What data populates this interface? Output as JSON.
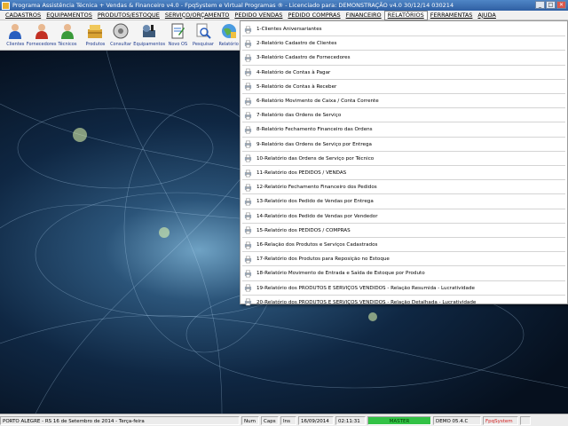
{
  "window": {
    "title": "Programa Assistência Técnica + Vendas & Financeiro v4.0 - FpqSystem e Virtual Programas ® - Licenciado para: DEMONSTRAÇÃO v4.0 30/12/14 030214",
    "minimize": "_",
    "maximize": "□",
    "close": "✕"
  },
  "menubar": {
    "items": [
      "CADASTROS",
      "EQUIPAMENTOS",
      "PRODUTOS/ESTOQUE",
      "SERVIÇO/ORÇAMENTO",
      "PEDIDO VENDAS",
      "PEDIDO COMPRAS",
      "FINANCEIRO",
      "RELATÓRIOS",
      "FERRAMENTAS",
      "AJUDA"
    ],
    "active_index": 7
  },
  "toolbar": {
    "buttons": [
      {
        "label": "Clientes",
        "icon": "user-blue-icon"
      },
      {
        "label": "Fornecedores",
        "icon": "user-red-icon"
      },
      {
        "label": "Técnicos",
        "icon": "user-green-icon"
      },
      {
        "label": "Produtos",
        "icon": "products-box-icon"
      },
      {
        "label": "Consultar",
        "icon": "disc-icon"
      },
      {
        "label": "Equipamentos",
        "icon": "equipment-icon"
      },
      {
        "label": "Novo OS",
        "icon": "new-order-icon"
      },
      {
        "label": "Pesquisar",
        "icon": "search-icon"
      },
      {
        "label": "Relatório",
        "icon": "report-globe-icon"
      }
    ]
  },
  "reports_menu": {
    "items": [
      "1-Clientes Aniversariantes",
      "2-Relatório Cadastro de Clientes",
      "3-Relatório Cadastro de Fornecedores",
      "4-Relatório de Contas à Pagar",
      "5-Relatório de Contas à Receber",
      "6-Relatório Movimento de Caixa / Conta Corrente",
      "7-Relatório das Ordens de Serviço",
      "8-Relatório Fechamento Financeiro das Ordens",
      "9-Relatório das Ordens de Serviço por Entrega",
      "10-Relatório das Ordens de Serviço por Técnico",
      "11-Relatório dos PEDIDOS / VENDAS",
      "12-Relatório Fechamento Financeiro dos Pedidos",
      "13-Relatório dos Pedido de Vendas por Entrega",
      "14-Relatório dos Pedido de Vendas por Vendedor",
      "15-Relatório dos PEDIDOS / COMPRAS",
      "16-Relação dos Produtos e Serviços Cadastrados",
      "17-Relatório dos Produtos para Reposição no Estoque",
      "18-Relatório Movimento de Entrada e Saída de Estoque por Produto",
      "19-Relatório dos PRODUTOS E SERVIÇOS VENDIDOS - Relação Resumida - Lucratividade",
      "20-Relatório dos PRODUTOS E SERVIÇOS VENDIDOS - Relação Detalhada - Lucratividade"
    ]
  },
  "statusbar": {
    "location_date": "PORTO ALEGRE - RS 16 de Setembro de 2014 - Terça-feira",
    "num": "Num",
    "caps": "Caps",
    "blank1": "Ins",
    "date": "16/09/2014",
    "time": "02:11:31",
    "user": "MASTER",
    "version": "DEMO 05.4.C",
    "brand": "FpqSystem"
  },
  "colors": {
    "accent": "#2f5fa3",
    "status_green": "#33c246",
    "brand_red": "#d32020"
  }
}
